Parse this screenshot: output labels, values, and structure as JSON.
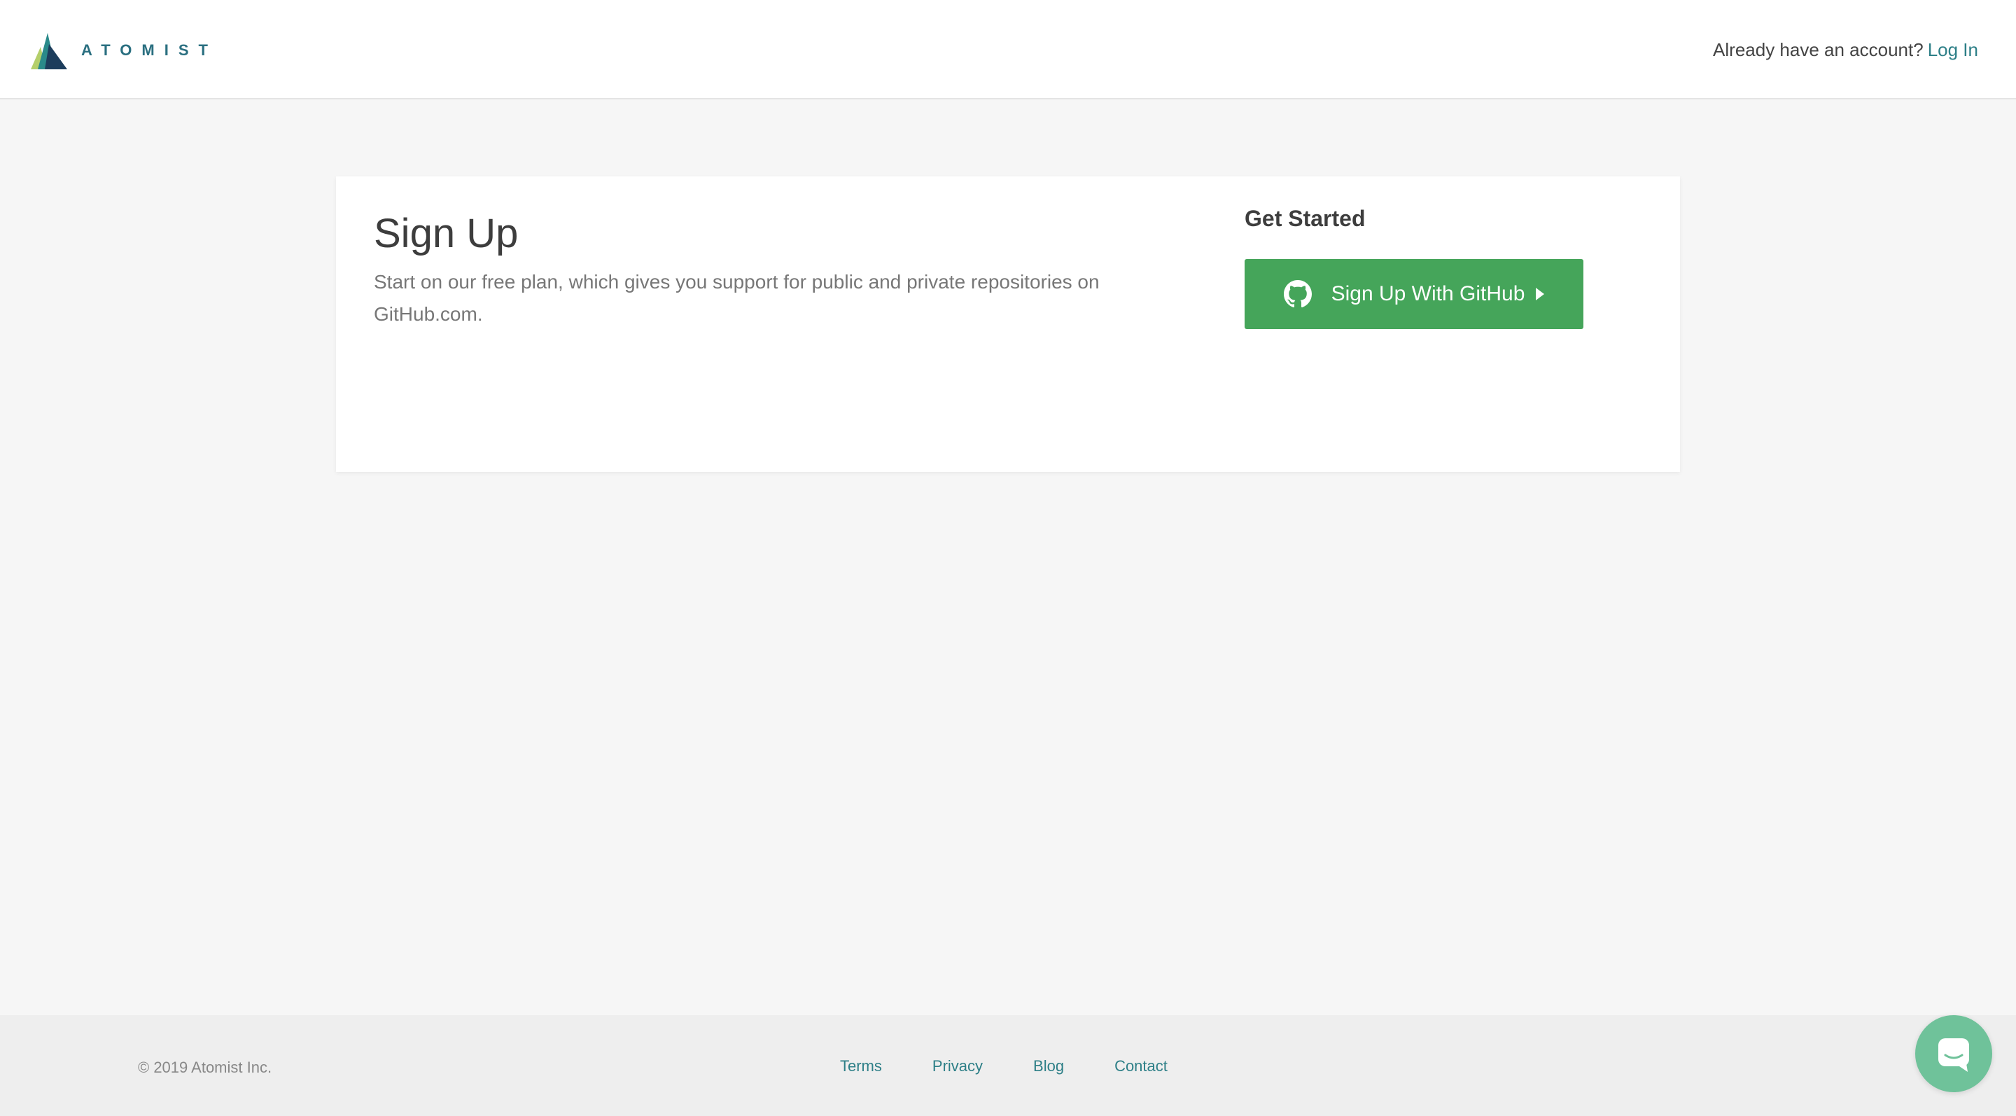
{
  "header": {
    "logo_text": "ATOMIST",
    "account_prompt": "Already have an account?",
    "login_label": "Log In"
  },
  "signup": {
    "title": "Sign Up",
    "description": "Start on our free plan, which gives you support for public and private repositories on GitHub.com.",
    "get_started": "Get Started",
    "github_button_label": "Sign Up With GitHub"
  },
  "footer": {
    "copyright": "© 2019 Atomist Inc.",
    "links": [
      "Terms",
      "Privacy",
      "Blog",
      "Contact"
    ]
  },
  "colors": {
    "accent": "#2d7f87",
    "github_button": "#45a55a",
    "chat_bubble": "#6fc29a",
    "background": "#f6f6f6"
  },
  "icons": {
    "logo": "atomist-logo-icon",
    "github": "github-icon",
    "caret": "caret-right-icon",
    "chat": "chat-icon"
  }
}
